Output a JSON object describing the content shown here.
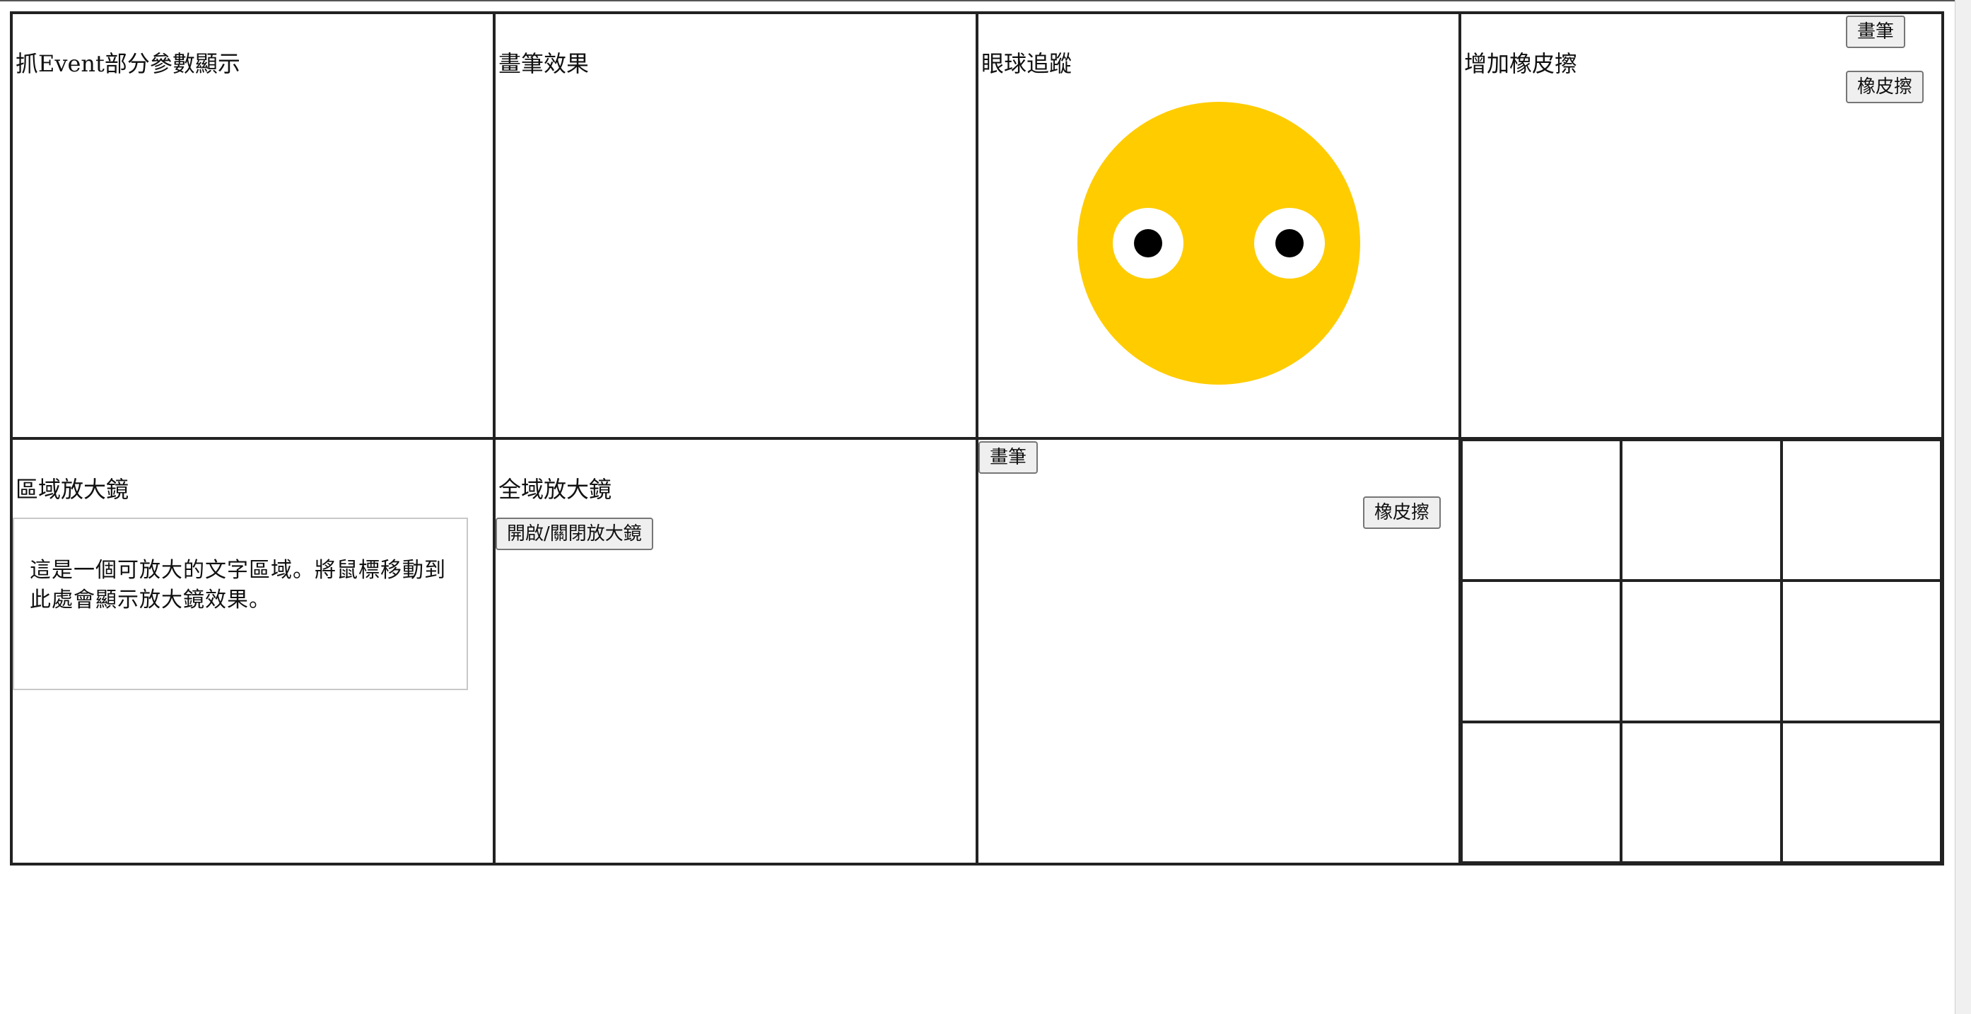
{
  "panels": {
    "event_params": {
      "title": "抓Event部分參數顯示"
    },
    "brush_effect": {
      "title": "畫筆效果"
    },
    "eye_tracking": {
      "title": "眼球追蹤"
    },
    "add_eraser": {
      "title": "增加橡皮擦",
      "brush_button": "畫筆",
      "eraser_button": "橡皮擦"
    },
    "area_magnifier": {
      "title": "區域放大鏡",
      "text": "這是一個可放大的文字區域。將鼠標移動到此處會顯示放大鏡效果。"
    },
    "global_magnifier": {
      "title": "全域放大鏡",
      "toggle_button": "開啟/關閉放大鏡"
    },
    "canvas_tools": {
      "brush_button": "畫筆",
      "eraser_button": "橡皮擦"
    },
    "tic_tac_toe": {
      "cells": [
        "",
        "",
        "",
        "",
        "",
        "",
        "",
        "",
        ""
      ]
    }
  },
  "colors": {
    "face": "#ffcc00",
    "eye_white": "#ffffff",
    "pupil": "#000000",
    "border": "#222222"
  }
}
